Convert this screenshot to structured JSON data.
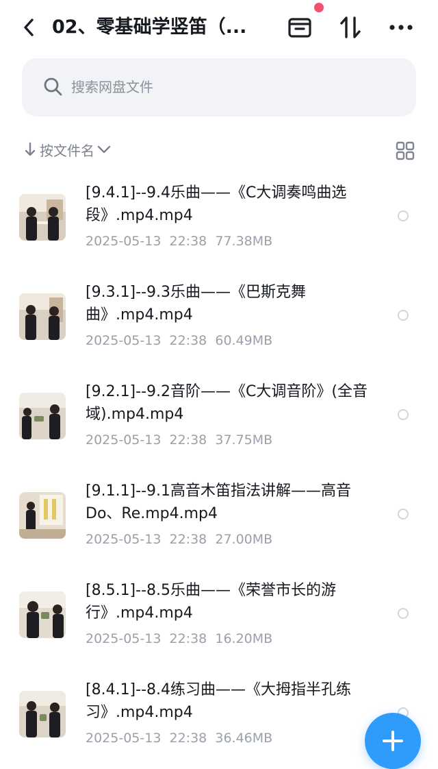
{
  "header": {
    "title": "02、零基础学竖笛（...",
    "icons": [
      "back-icon",
      "archive-icon",
      "sort-arrows-icon",
      "more-icon"
    ],
    "badge_color": "#f25070"
  },
  "search": {
    "placeholder": "搜索网盘文件"
  },
  "sort": {
    "label": "按文件名"
  },
  "files": [
    {
      "name": "[9.4.1]--9.4乐曲——《C大调奏鸣曲选段》.mp4.mp4",
      "date": "2025-05-13  22:38",
      "size": "77.38MB"
    },
    {
      "name": "[9.3.1]--9.3乐曲——《巴斯克舞曲》.mp4.mp4",
      "date": "2025-05-13  22:38",
      "size": "60.49MB"
    },
    {
      "name": "[9.2.1]--9.2音阶——《C大调音阶》(全音域).mp4.mp4",
      "date": "2025-05-13  22:38",
      "size": "37.75MB"
    },
    {
      "name": "[9.1.1]--9.1高音木笛指法讲解——高音Do、Re.mp4.mp4",
      "date": "2025-05-13  22:38",
      "size": "27.00MB"
    },
    {
      "name": "[8.5.1]--8.5乐曲——《荣誉市长的游行》.mp4.mp4",
      "date": "2025-05-13  22:38",
      "size": "16.20MB"
    },
    {
      "name": "[8.4.1]--8.4练习曲——《大拇指半孔练习》.mp4.mp4",
      "date": "2025-05-13  22:38",
      "size": "36.46MB"
    }
  ],
  "fab": {
    "icon": "plus-icon",
    "color": "#2f9cfb"
  },
  "colors": {
    "accent": "#2f9cfb",
    "search_bg": "#f1f3f7",
    "meta_text": "#9aa0aa"
  }
}
